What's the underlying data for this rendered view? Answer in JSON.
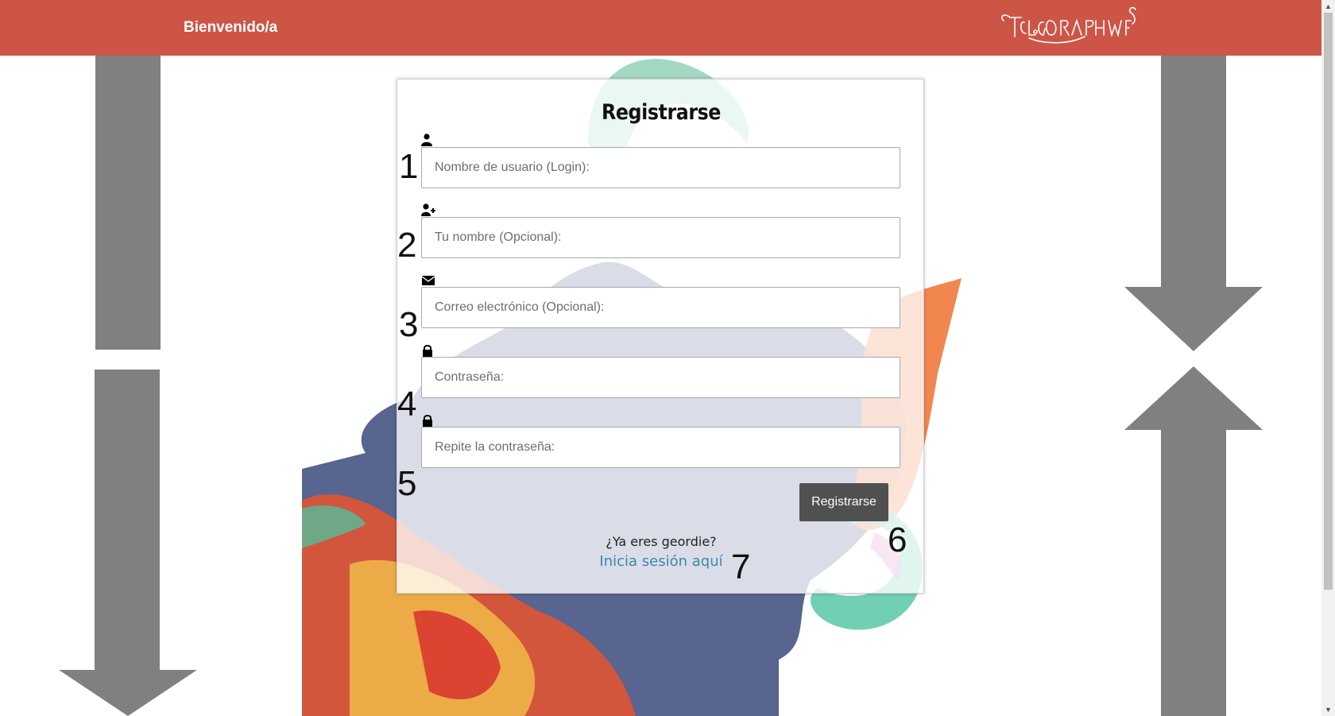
{
  "header": {
    "welcome": "Bienvenido/a",
    "logo_text": "TELEGRAPH WEB"
  },
  "form": {
    "title": "Registrarse",
    "fields": [
      {
        "icon": "user-icon",
        "placeholder": "Nombre de usuario (Login):",
        "value": "",
        "annotation": "1"
      },
      {
        "icon": "user-plus-icon",
        "placeholder": "Tu nombre (Opcional):",
        "value": "",
        "annotation": "2"
      },
      {
        "icon": "envelope-icon",
        "placeholder": "Correo electrónico (Opcional):",
        "value": "",
        "annotation": "3"
      },
      {
        "icon": "lock-icon",
        "placeholder": "Contraseña:",
        "value": "",
        "annotation": "4"
      },
      {
        "icon": "lock-icon",
        "placeholder": "Repite la contraseña:",
        "value": "",
        "annotation": "5"
      }
    ],
    "submit_label": "Registrarse",
    "submit_annotation": "6",
    "already_text": "¿Ya eres geordie?",
    "login_link": "Inicia sesión aquí",
    "login_annotation": "7"
  },
  "colors": {
    "header_bg": "#cc5546",
    "button_bg": "#505050",
    "link": "#3d86b0",
    "arrow": "#808080"
  }
}
